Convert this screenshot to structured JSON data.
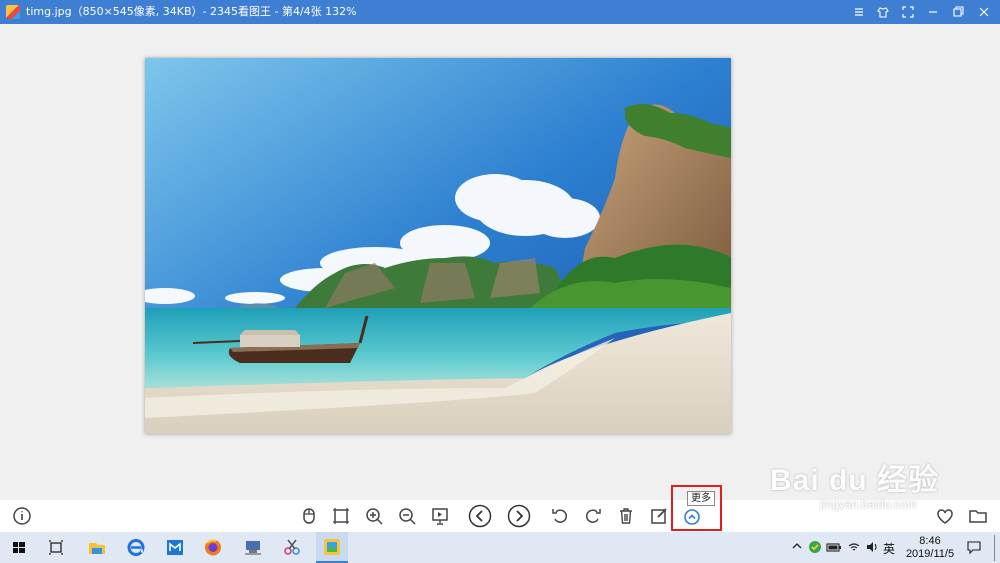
{
  "window": {
    "title": "timg.jpg（850×545像素, 34KB）- 2345看图王 - 第4/4张 132%"
  },
  "toolbar": {
    "buttons": [
      "info",
      "fullscreen",
      "fit-window",
      "zoom-in",
      "zoom-out",
      "slideshow",
      "previous",
      "next",
      "rotate-left",
      "rotate-right",
      "delete",
      "edit",
      "more",
      "favorite",
      "open-folder"
    ],
    "more_tooltip": "更多"
  },
  "watermark": {
    "logo": "Bai du 经验",
    "site": "jingyan.baidu.com"
  },
  "taskbar": {
    "tray_lang": "英",
    "time": "8:46",
    "date": "2019/11/5"
  },
  "colors": {
    "titlebar": "#3e7fd4",
    "highlight": "#e02020",
    "more_button": "#2f7de0"
  }
}
